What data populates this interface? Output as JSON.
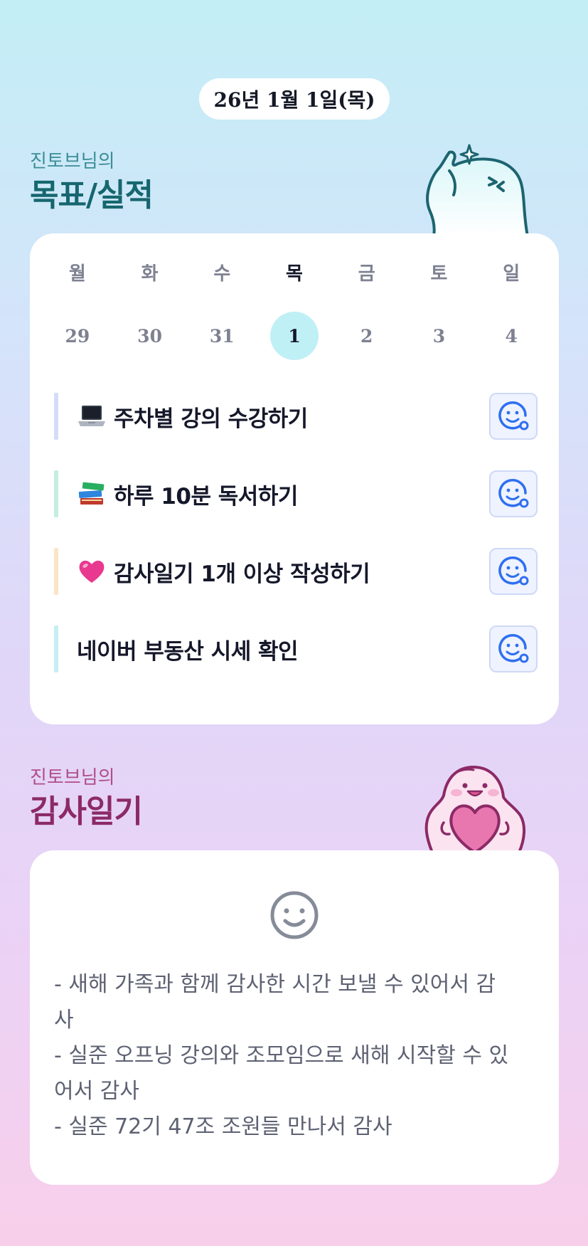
{
  "header": {
    "date": "26년 1월 1일(목)"
  },
  "goals_section": {
    "subtitle": "진토브님의",
    "title": "목표/실적"
  },
  "calendar": {
    "day_names": [
      "월",
      "화",
      "수",
      "목",
      "금",
      "토",
      "일"
    ],
    "day_numbers": [
      "29",
      "30",
      "31",
      "1",
      "2",
      "3",
      "4"
    ],
    "selected_index": 3,
    "selected_color": "#bff0f5"
  },
  "goals": [
    {
      "emoji": "laptop-icon",
      "label": "주차별 강의 수강하기",
      "bar_color": "#d3dcf8"
    },
    {
      "emoji": "books-icon",
      "label": "하루 10분 독서하기",
      "bar_color": "#c4eedf"
    },
    {
      "emoji": "pink-heart-icon",
      "label": "감사일기 1개 이상 작성하기",
      "bar_color": "#fde3c6"
    },
    {
      "emoji": "",
      "label": "네이버 부동산 시세 확인",
      "bar_color": "#c6eef5"
    }
  ],
  "goal_button_icon": "smile-face-add-icon",
  "diary_section": {
    "subtitle": "진토브님의",
    "title": "감사일기"
  },
  "diary": {
    "icon": "smile-face-icon",
    "lines": [
      "- 새해 가족과 함께 감사한 시간 보낼 수 있어서 감",
      "사",
      "- 실준 오프닝 강의와 조모임으로 새해 시작할 수 있",
      "어서 감사",
      "- 실준 72기 47조 조원들 만나서 감사"
    ]
  },
  "colors": {
    "goal_title": "#16666f",
    "diary_title": "#8c2a66",
    "accent_blue": "#2f6ff0"
  }
}
